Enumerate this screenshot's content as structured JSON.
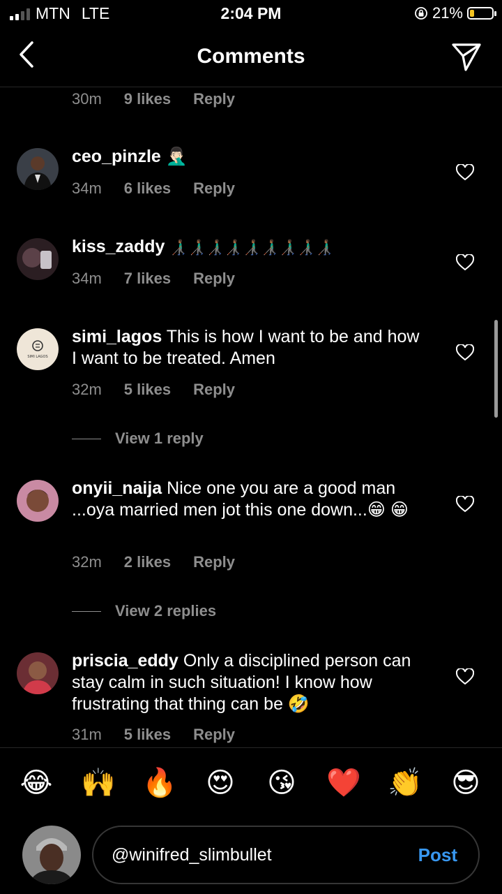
{
  "status_bar": {
    "carrier": "MTN",
    "network": "LTE",
    "time": "2:04 PM",
    "battery": "21%",
    "battery_level": 0.21,
    "battery_color": "#f4c320"
  },
  "header": {
    "title": "Comments",
    "back_icon": "chevron-left-icon",
    "send_icon": "paper-plane-icon"
  },
  "partial_comment": {
    "time": "30m",
    "likes": "9 likes",
    "reply": "Reply"
  },
  "comments": [
    {
      "user": "ceo_pinzle",
      "text": "🤦🏻‍♂️",
      "time": "34m",
      "likes": "6 likes",
      "reply": "Reply"
    },
    {
      "user": "kiss_zaddy",
      "text": "👨🏾‍🦯👨🏾‍🦯👨🏾‍🦯👨🏾‍🦯👨🏾‍🦯👨🏾‍🦯👨🏾‍🦯👨🏾‍🦯👨🏾‍🦯",
      "time": "34m",
      "likes": "7 likes",
      "reply": "Reply"
    },
    {
      "user": "simi_lagos",
      "text": "This is how I want to be and how I want to be treated. Amen",
      "time": "32m",
      "likes": "5 likes",
      "reply": "Reply",
      "view_replies": "View 1 reply"
    },
    {
      "user": "onyii_naija",
      "text": "Nice one you are a good man ...oya married men jot this one down...😁 😁",
      "time": "32m",
      "likes": "2 likes",
      "reply": "Reply",
      "view_replies": "View 2 replies"
    },
    {
      "user": "priscia_eddy",
      "text": "Only a disciplined person can stay calm in such situation! I know how frustrating that thing can be 🤣",
      "time": "31m",
      "likes": "5 likes",
      "reply": "Reply"
    }
  ],
  "avatar_logo_text": "SIMI LAGOS",
  "emoji_bar": [
    "😂",
    "🙌",
    "🔥",
    "😍",
    "😘",
    "❤️",
    "👏",
    "😎"
  ],
  "composer": {
    "value": "@winifred_slimbullet",
    "post_label": "Post"
  },
  "colors": {
    "background": "#000000",
    "secondary_text": "#8e8e8e",
    "accent": "#3897f0",
    "divider": "#262626"
  }
}
